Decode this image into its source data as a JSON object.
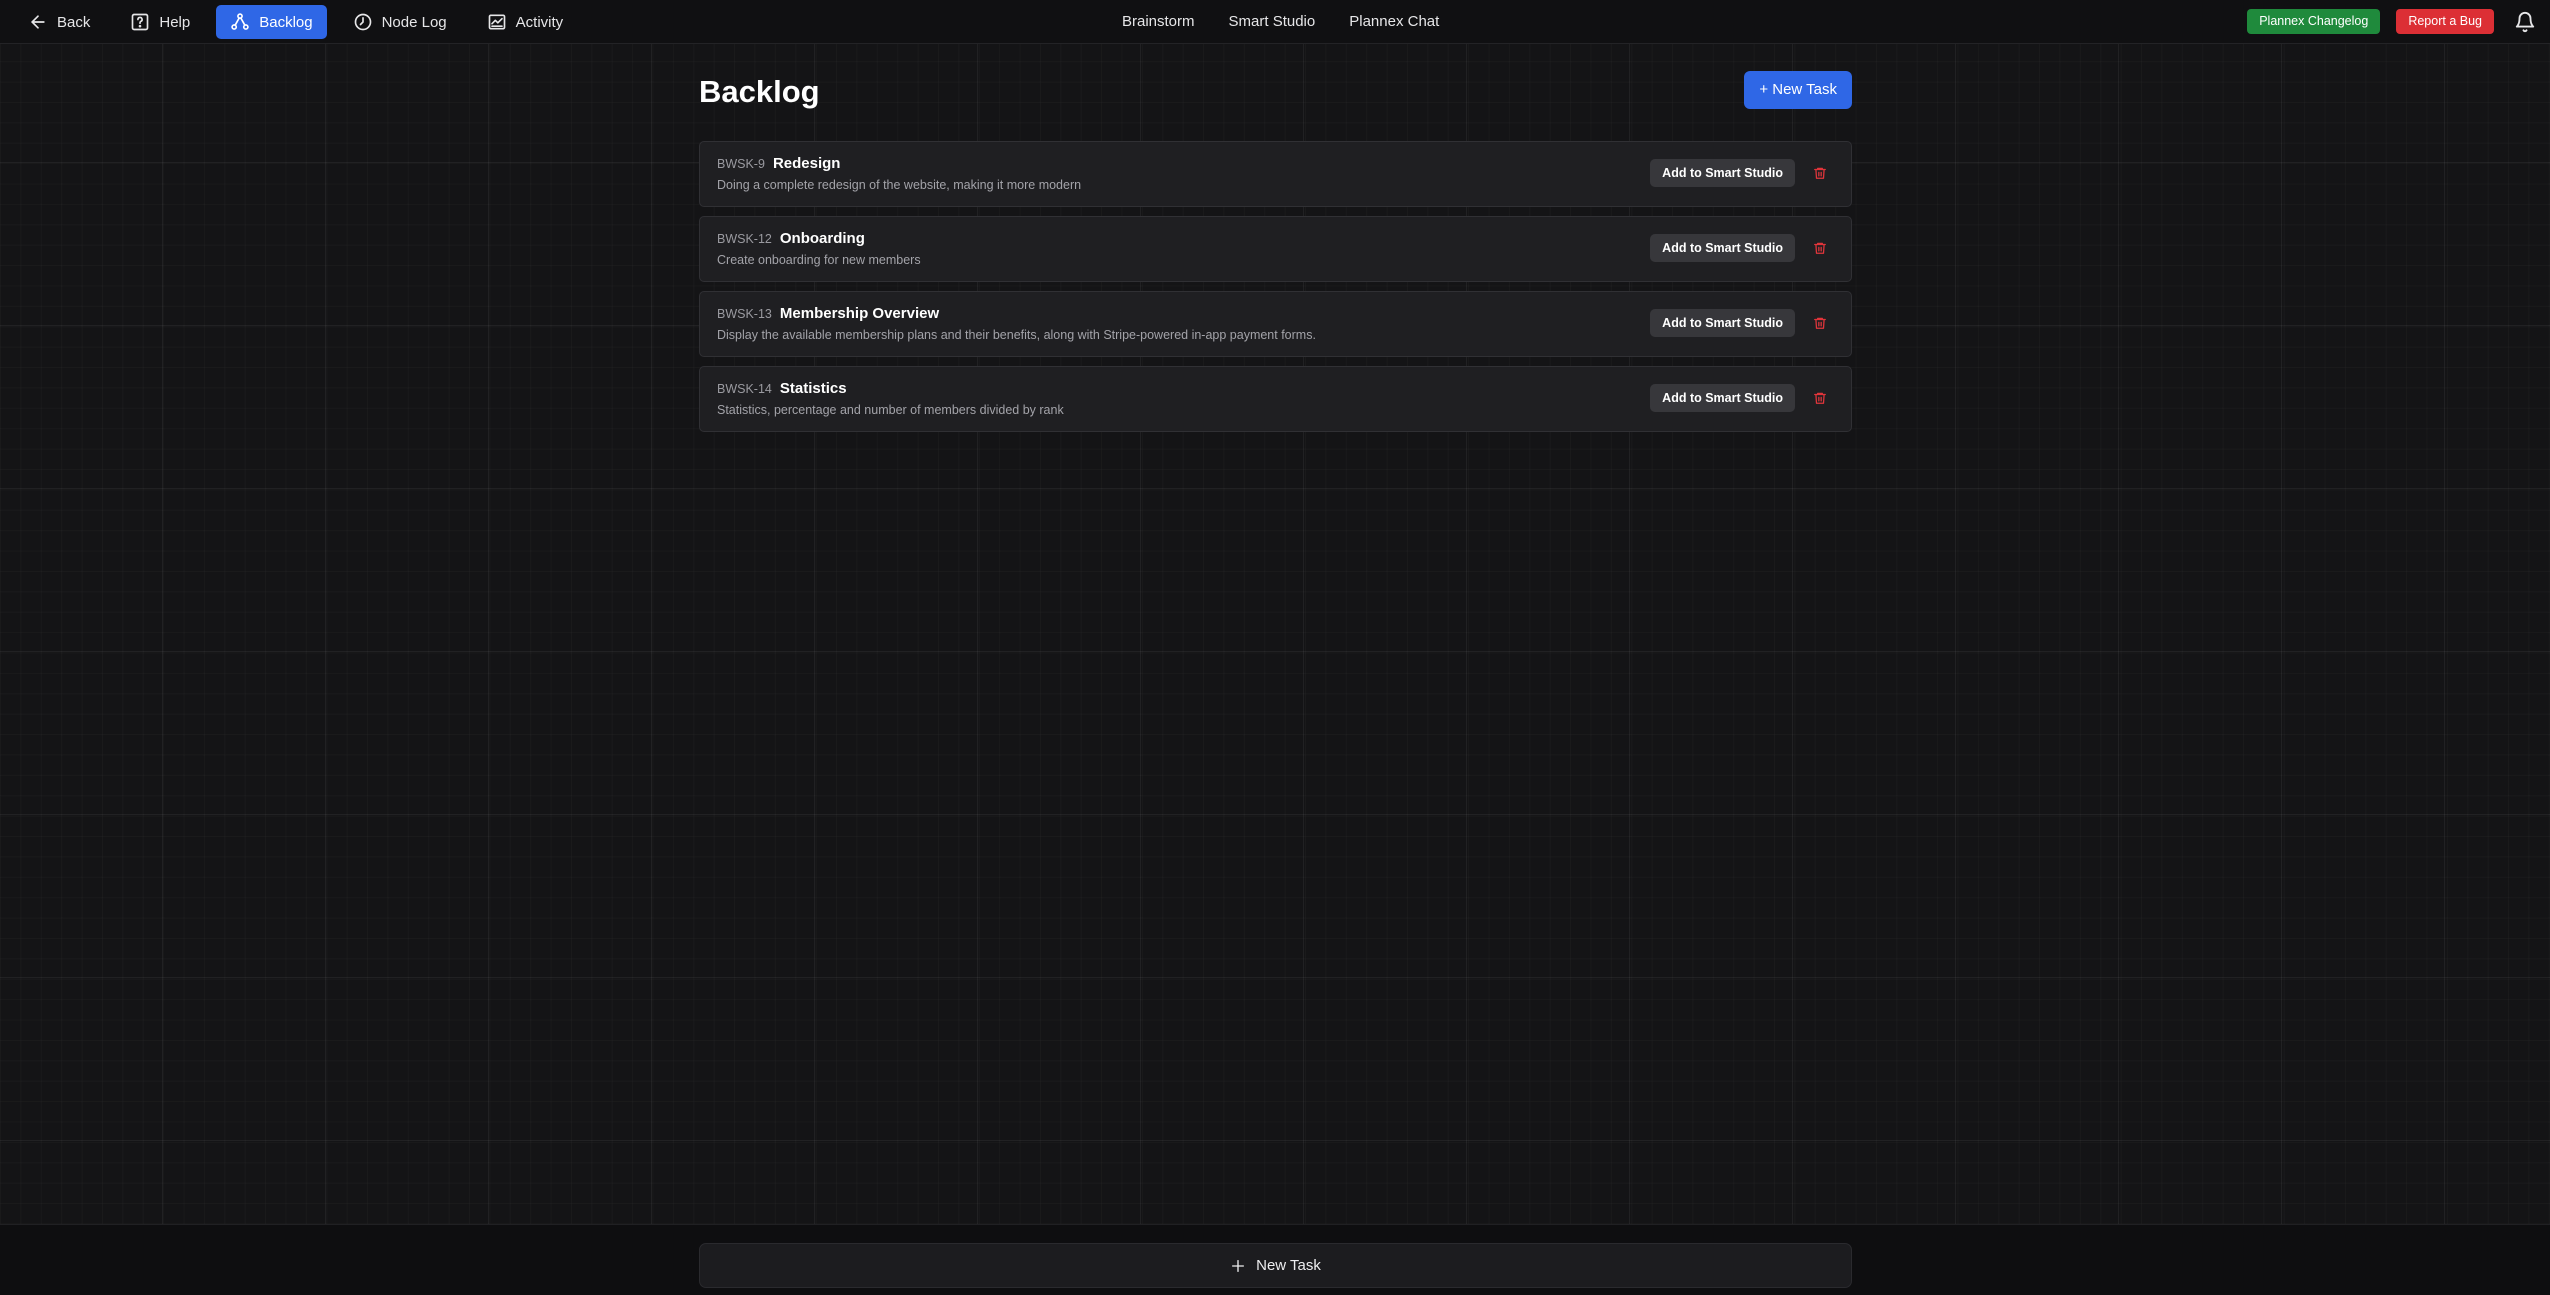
{
  "topbar": {
    "left": [
      {
        "label": "Back",
        "icon": "arrow-left-icon",
        "active": false
      },
      {
        "label": "Help",
        "icon": "help-icon",
        "active": false
      },
      {
        "label": "Backlog",
        "icon": "backlog-nodes-icon",
        "active": true
      },
      {
        "label": "Node Log",
        "icon": "clock-icon",
        "active": false
      },
      {
        "label": "Activity",
        "icon": "activity-chart-icon",
        "active": false
      }
    ],
    "center": [
      "Brainstorm",
      "Smart Studio",
      "Plannex Chat"
    ],
    "changelog_label": "Plannex Changelog",
    "report_bug_label": "Report a Bug",
    "notifications_icon": "bell-icon"
  },
  "colors": {
    "accent": "#2f67e6",
    "changelog_green": "#1f8a3c",
    "bug_red": "#dc2f35",
    "background": "#141416",
    "card": "#1f1f22"
  },
  "page": {
    "title": "Backlog",
    "new_task_label": "+ New Task"
  },
  "tasks": [
    {
      "id": "BWSK-9",
      "title": "Redesign",
      "description": "Doing a complete redesign of the website, making it more modern",
      "action_label": "Add to Smart Studio"
    },
    {
      "id": "BWSK-12",
      "title": "Onboarding",
      "description": "Create onboarding for new members",
      "action_label": "Add to Smart Studio"
    },
    {
      "id": "BWSK-13",
      "title": "Membership Overview",
      "description": "Display the available membership plans and their benefits, along with Stripe-powered in-app payment forms.",
      "action_label": "Add to Smart Studio"
    },
    {
      "id": "BWSK-14",
      "title": "Statistics",
      "description": "Statistics, percentage and number of members divided by rank",
      "action_label": "Add to Smart Studio"
    }
  ],
  "bottombar": {
    "new_task_label": "New Task"
  }
}
